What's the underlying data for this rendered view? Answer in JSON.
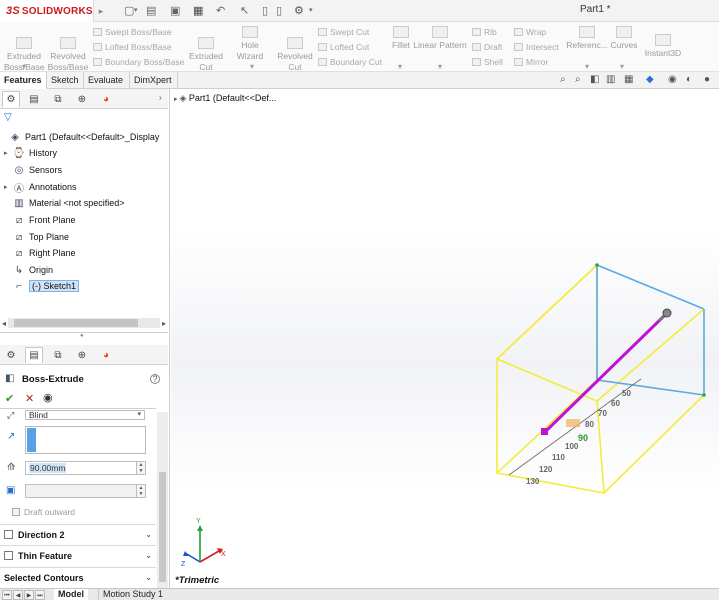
{
  "app": {
    "brand": "SOLIDWORKS",
    "brand_prefix": "3S",
    "document_title": "Part1 *",
    "quick_access": [
      "new-icon",
      "open-icon",
      "save-icon",
      "print-icon",
      "undo-icon",
      "select-icon",
      "rebuild-icon",
      "options-icon"
    ]
  },
  "command_manager": {
    "extruded_boss": "Extruded\nBoss/Base",
    "revolved_boss": "Revolved\nBoss/Base",
    "swept_boss": "Swept Boss/Base",
    "lofted_boss": "Lofted Boss/Base",
    "boundary_boss": "Boundary Boss/Base",
    "extruded_cut": "Extruded\nCut",
    "hole_wizard": "Hole Wizard",
    "revolved_cut": "Revolved\nCut",
    "swept_cut": "Swept Cut",
    "lofted_cut": "Lofted Cut",
    "boundary_cut": "Boundary Cut",
    "fillet": "Fillet",
    "linear_pattern": "Linear Pattern",
    "rib": "Rib",
    "draft": "Draft",
    "shell": "Shell",
    "wrap": "Wrap",
    "intersect": "Intersect",
    "mirror": "Mirror",
    "reference": "Referenc...",
    "curves": "Curves",
    "instant3d": "Instant3D"
  },
  "tabs": [
    "Features",
    "Sketch",
    "Evaluate",
    "DimXpert"
  ],
  "active_tab": "Features",
  "feature_tree": {
    "root": "Part1  (Default<<Default>_Display",
    "items": [
      {
        "label": "History",
        "icon": "history-icon",
        "expandable": true
      },
      {
        "label": "Sensors",
        "icon": "sensors-icon",
        "expandable": false
      },
      {
        "label": "Annotations",
        "icon": "annotations-icon",
        "expandable": true
      },
      {
        "label": "Material <not specified>",
        "icon": "material-icon",
        "expandable": false
      },
      {
        "label": "Front Plane",
        "icon": "plane-icon",
        "expandable": false
      },
      {
        "label": "Top Plane",
        "icon": "plane-icon",
        "expandable": false
      },
      {
        "label": "Right Plane",
        "icon": "plane-icon",
        "expandable": false
      },
      {
        "label": "Origin",
        "icon": "origin-icon",
        "expandable": false
      },
      {
        "label": "(-) Sketch1",
        "icon": "sketch-icon",
        "expandable": false,
        "selected": true
      }
    ]
  },
  "property_manager": {
    "title": "Boss-Extrude",
    "end_condition": "Blind",
    "depth": "90.00mm",
    "draft_outward": "Draft outward",
    "direction2": "Direction 2",
    "thin_feature": "Thin Feature",
    "selected_contours": "Selected Contours"
  },
  "viewport": {
    "tree_label": "Part1  (Default<<Def...",
    "view_name": "*Trimetric",
    "ruler_labels": [
      "50",
      "60",
      "70",
      "80",
      "90",
      "100",
      "110",
      "120",
      "130"
    ],
    "colors": {
      "preview_box": "#f3ec3a",
      "selected_edge": "#5aa9e6",
      "extrude_arrow": "#c012d6",
      "axis_x": "#d02020",
      "axis_y": "#20a040",
      "axis_z": "#2050d0"
    },
    "axis_labels": {
      "x": "X",
      "y": "Y",
      "z": "Z"
    }
  },
  "bottom_tabs": [
    "Model",
    "Motion Study 1"
  ],
  "active_bottom_tab": "Model"
}
